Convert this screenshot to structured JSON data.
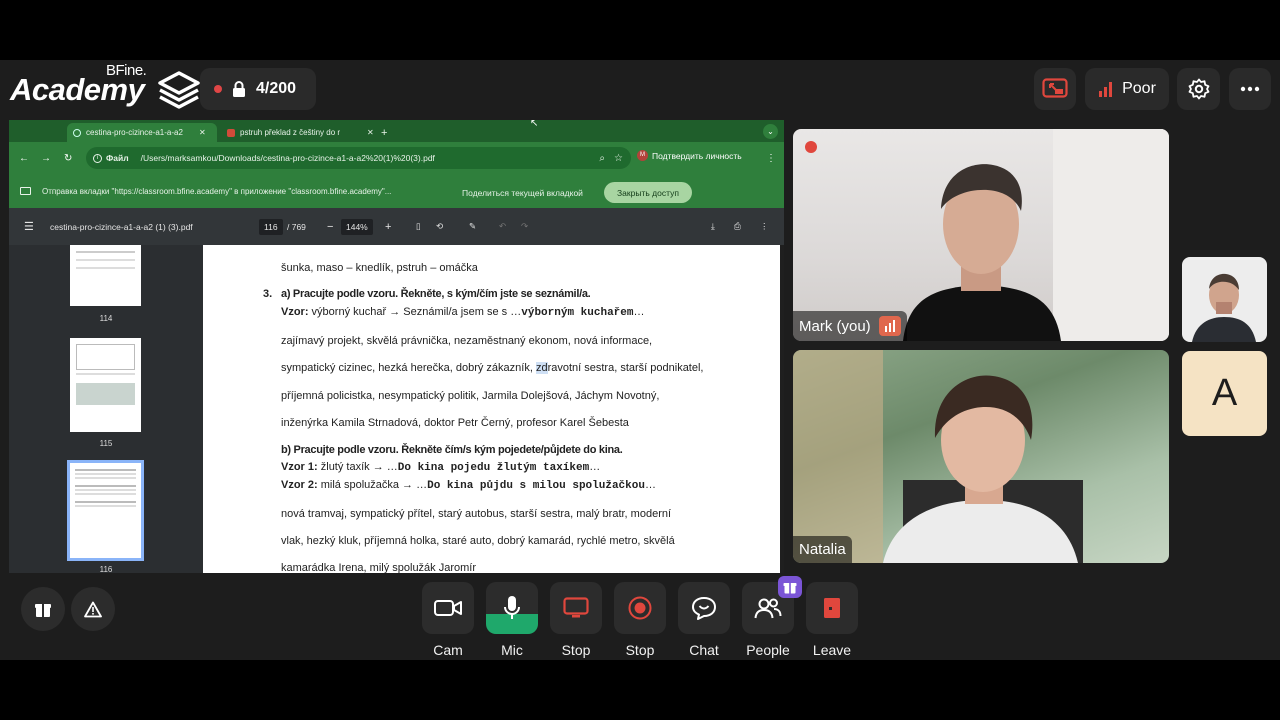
{
  "brand": {
    "name": "Academy",
    "super": "BFine."
  },
  "recording": {
    "count": "4/200"
  },
  "top_right": {
    "connection": "Poor"
  },
  "browser": {
    "tabs": [
      {
        "label": "cestina-pro-cizince-a1-a-a2"
      },
      {
        "label": "pstruh překlad z češtiny do r"
      }
    ],
    "address_label": "Файл",
    "url": "/Users/marksamkou/Downloads/cestina-pro-cizince-a1-a-a2%20(1)%20(3).pdf",
    "verify": "Подтвердить личность",
    "info": "Отправка вкладки \"https://classroom.bfine.academy\" в приложение \"classroom.bfine.academy\"...",
    "share_btn": "Поделиться текущей вкладкой",
    "close_btn": "Закрыть доступ"
  },
  "pdf": {
    "filename": "cestina-pro-cizince-a1-a-a2 (1) (3).pdf",
    "page_current": "116",
    "page_total": "/ 769",
    "zoom": "144%",
    "thumb_labels": [
      "114",
      "115",
      "116"
    ],
    "lines": {
      "l1": "šunka, maso – knedlík, pstruh – omáčka",
      "ex_num": "3.",
      "ex_a": "a) Pracujte podle vzoru. Řekněte, s kým/čím jste se seznámil/a.",
      "vzor_label": "Vzor:",
      "vzor_text": " výborný kuchař → Seznámil/a jsem se s …",
      "vzor_answer": "výborným kuchařem",
      "vzor_tail": "…",
      "l2": "zajímavý projekt, skvělá právnička, nezaměstnaný ekonom, nová informace,",
      "l3a": "sympatický cizinec, hezká herečka, dobrý zákazník, ",
      "l3hl": "zd",
      "l3b": "ravotní sestra, starší podnikatel,",
      "l4": "příjemná policistka, nesympatický politik, Jarmila Dolejšová, Jáchym Novotný,",
      "l5": "inženýrka Kamila Strnadová, doktor Petr Černý, profesor Karel Šebesta",
      "ex_b": "b) Pracujte podle vzoru. Řekněte čím/s kým pojedete/půjdete do kina.",
      "vzor1_label": "Vzor 1:",
      "vzor1_text": " žlutý taxík → …",
      "vzor1_answer": "Do kina pojedu žlutým taxíkem",
      "vzor2_label": "Vzor 2:",
      "vzor2_text": " milá spolužačka → …",
      "vzor2_answer": "Do kina půjdu s milou spolužačkou",
      "l6": "nová tramvaj, sympatický přítel, starý autobus, starší sestra, malý bratr, moderní",
      "l7": "vlak, hezký kluk, příjemná holka, staré auto, dobrý kamarád, rychlé metro, skvělá",
      "l8": "kamarádka Irena, milý spolužák Jaromír"
    }
  },
  "participants": [
    {
      "name": "Mark (you)"
    },
    {
      "name": "Natalia"
    }
  ],
  "avatar_letter": "A",
  "controls": [
    {
      "label": "Cam"
    },
    {
      "label": "Mic"
    },
    {
      "label": "Stop"
    },
    {
      "label": "Stop"
    },
    {
      "label": "Chat"
    },
    {
      "label": "People"
    },
    {
      "label": "Leave"
    }
  ],
  "colors": {
    "accent_green": "#2f7f3c",
    "mic_active": "#1fa86b",
    "leave_red": "#e0473d",
    "people_badge": "#7b55d6",
    "rec_red": "#e04646"
  }
}
